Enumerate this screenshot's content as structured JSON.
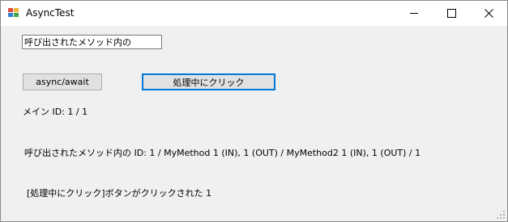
{
  "window": {
    "title": "AsyncTest",
    "app_icon": "winforms-app-icon",
    "controls": [
      "minimize-icon",
      "maximize-icon",
      "close-icon"
    ]
  },
  "form": {
    "textbox_value": "呼び出されたメソッド内の",
    "async_button_label": "async/await",
    "click_button_label": "処理中にクリック",
    "main_id_label": "メイン ID: 1 / 1",
    "method_label": "呼び出されたメソッド内の ID: 1 / MyMethod 1 (IN), 1 (OUT) / MyMethod2 1 (IN), 1 (OUT) / 1",
    "clicked_label": "[処理中にクリック]ボタンがクリックされた 1"
  },
  "colors": {
    "focus_border": "#0078d7",
    "client_background": "#f0f0f0",
    "titlebar_background": "#ffffff"
  }
}
